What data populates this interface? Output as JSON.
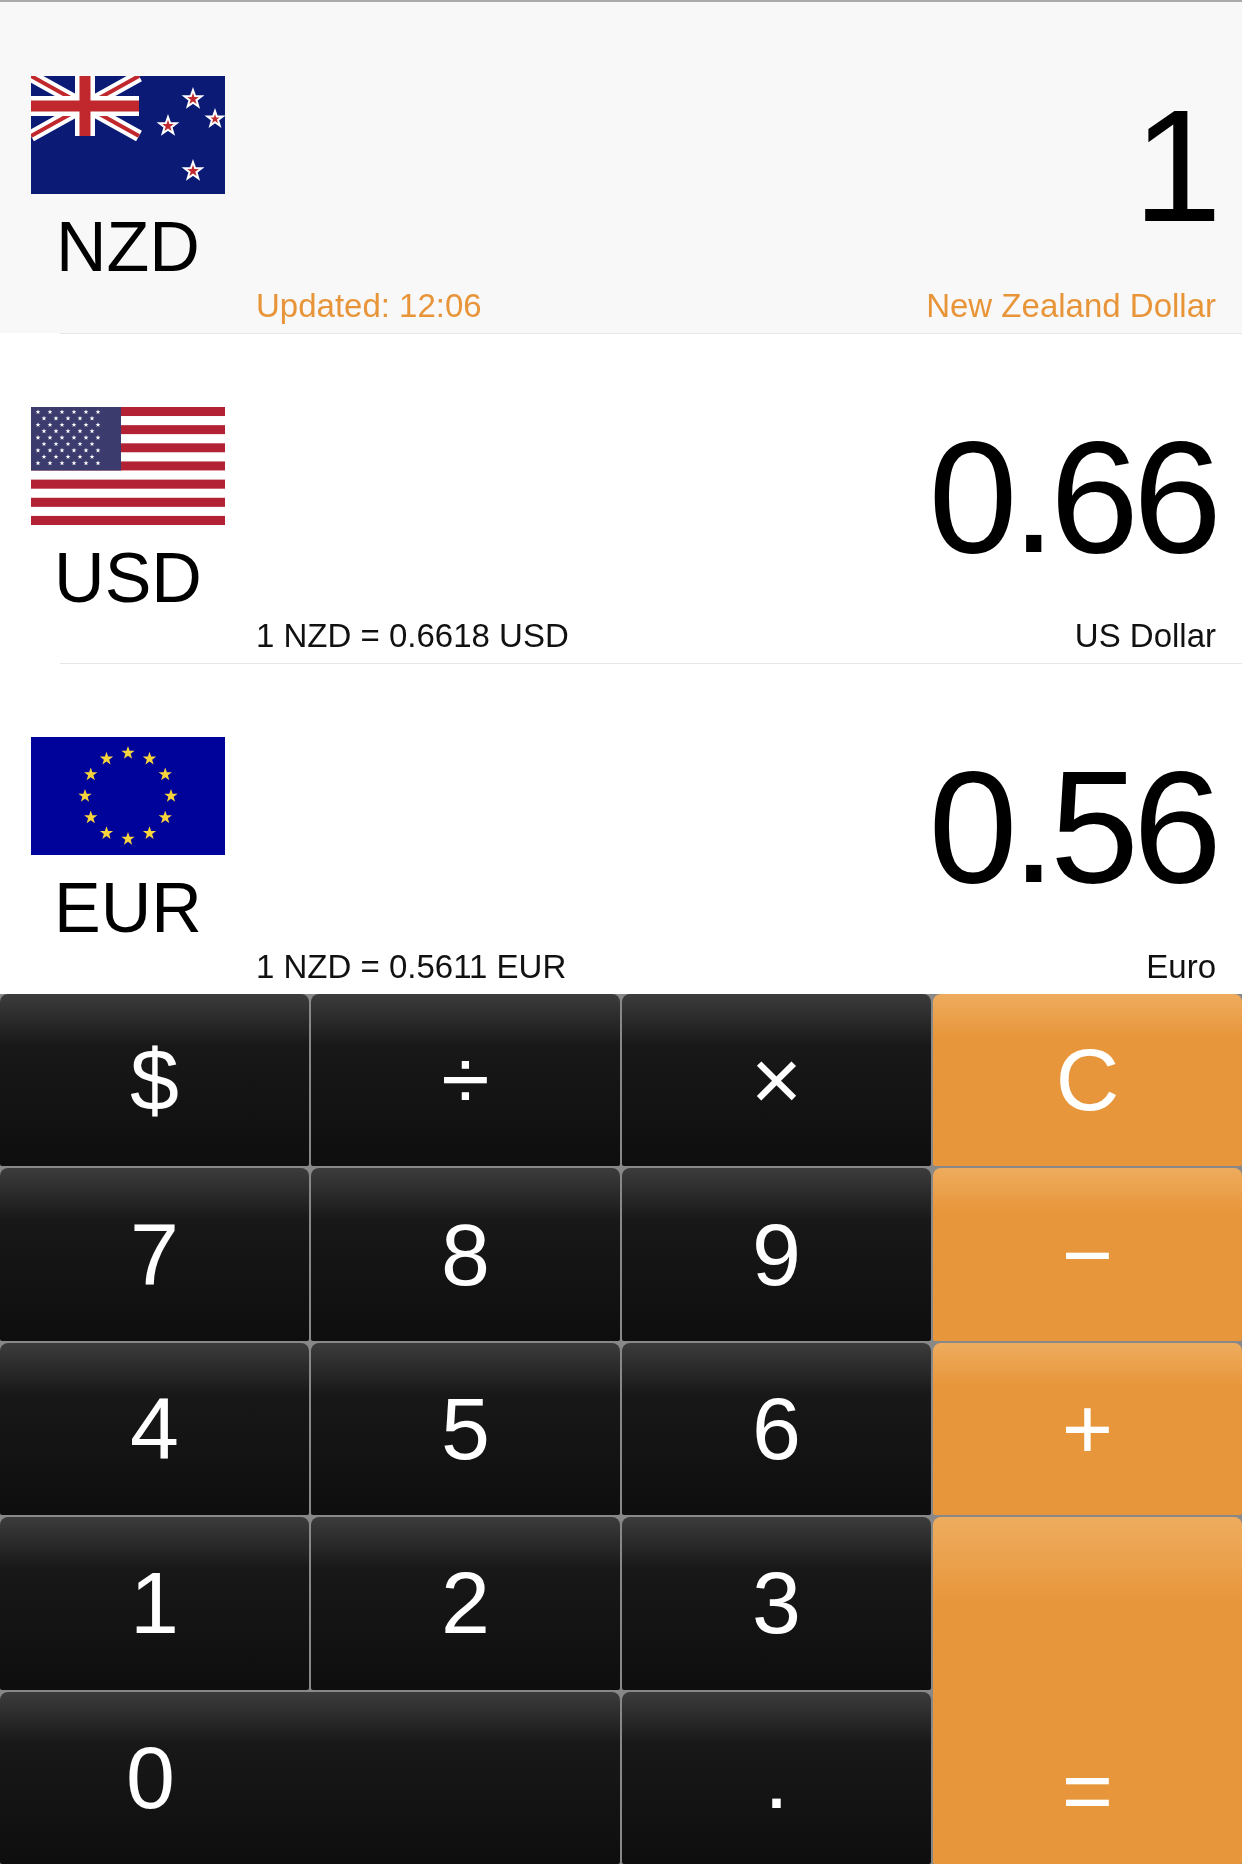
{
  "currencies": [
    {
      "code": "NZD",
      "amount": "1",
      "rate": "Updated: 12:06",
      "name": "New Zealand Dollar",
      "selected": true
    },
    {
      "code": "USD",
      "amount": "0.66",
      "rate": "1 NZD = 0.6618 USD",
      "name": "US Dollar",
      "selected": false
    },
    {
      "code": "EUR",
      "amount": "0.56",
      "rate": "1 NZD = 0.5611 EUR",
      "name": "Euro",
      "selected": false
    }
  ],
  "keypad": [
    {
      "label": "$",
      "kind": "dark"
    },
    {
      "label": "÷",
      "kind": "dark"
    },
    {
      "label": "×",
      "kind": "dark"
    },
    {
      "label": "C",
      "kind": "orange"
    },
    {
      "label": "7",
      "kind": "dark"
    },
    {
      "label": "8",
      "kind": "dark"
    },
    {
      "label": "9",
      "kind": "dark"
    },
    {
      "label": "−",
      "kind": "orange"
    },
    {
      "label": "4",
      "kind": "dark"
    },
    {
      "label": "5",
      "kind": "dark"
    },
    {
      "label": "6",
      "kind": "dark"
    },
    {
      "label": "+",
      "kind": "orange"
    },
    {
      "label": "1",
      "kind": "dark"
    },
    {
      "label": "2",
      "kind": "dark"
    },
    {
      "label": "3",
      "kind": "dark"
    },
    {
      "label": "0",
      "kind": "wide"
    },
    {
      "label": ".",
      "kind": "dark"
    },
    {
      "label": "=",
      "kind": "tall"
    }
  ]
}
